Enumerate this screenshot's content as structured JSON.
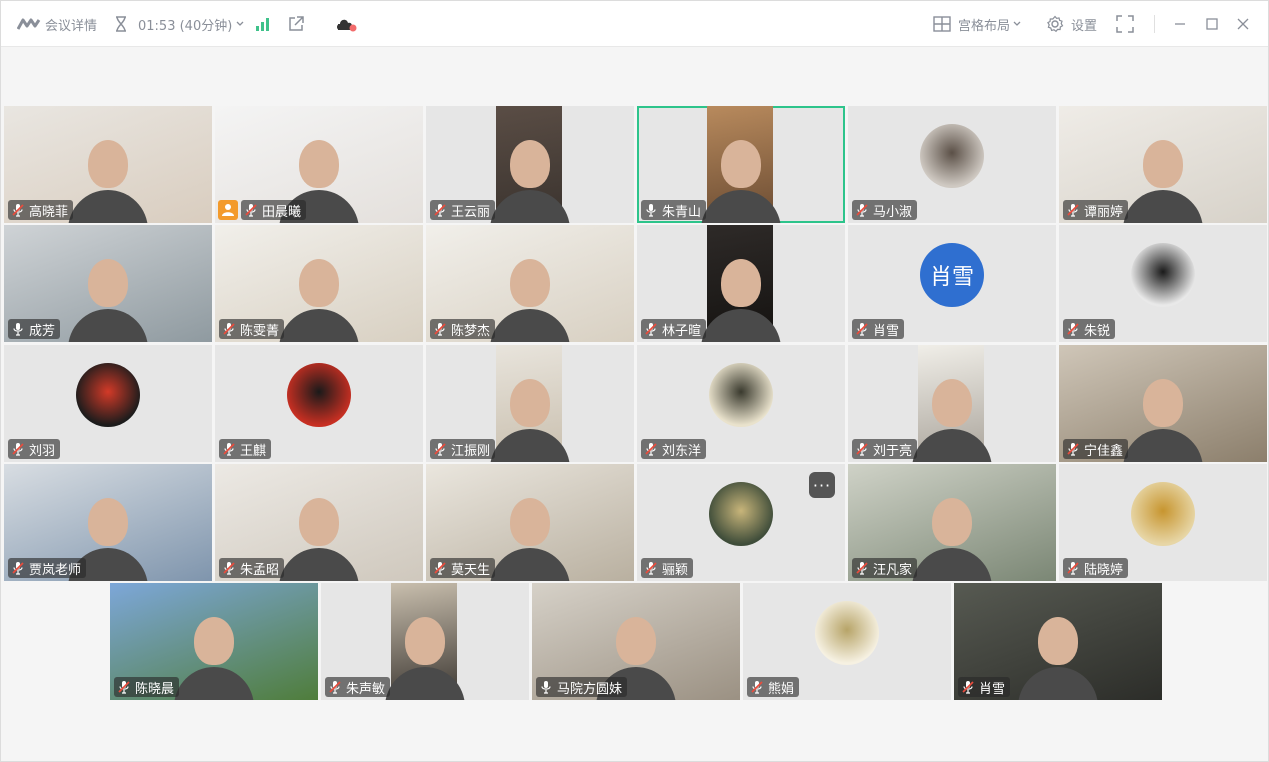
{
  "titlebar": {
    "meeting_details_label": "会议详情",
    "timer": "01:53 (40分钟)",
    "layout_label": "宫格布局",
    "settings_label": "设置"
  },
  "colors": {
    "accent": "#2dc48b",
    "host_badge": "#f39a2b",
    "avatar_text_bg": "#2f6fd0",
    "mic_muted": "#e84c3d"
  },
  "participants": [
    {
      "name": "高晓菲",
      "mic": "muted",
      "video": "on"
    },
    {
      "name": "田晨曦",
      "mic": "muted",
      "video": "on",
      "host": true
    },
    {
      "name": "王云丽",
      "mic": "muted",
      "video": "on"
    },
    {
      "name": "朱青山",
      "mic": "on",
      "video": "on",
      "speaking": true
    },
    {
      "name": "马小淑",
      "mic": "muted",
      "video": "off"
    },
    {
      "name": "谭丽婷",
      "mic": "muted",
      "video": "on"
    },
    {
      "name": "成芳",
      "mic": "on",
      "video": "on"
    },
    {
      "name": "陈雯菁",
      "mic": "muted",
      "video": "on"
    },
    {
      "name": "陈梦杰",
      "mic": "muted",
      "video": "on"
    },
    {
      "name": "林子暄",
      "mic": "muted",
      "video": "on"
    },
    {
      "name": "肖雪",
      "mic": "muted",
      "video": "off",
      "avatar_text": "肖雪"
    },
    {
      "name": "朱锐",
      "mic": "muted",
      "video": "off"
    },
    {
      "name": "刘羽",
      "mic": "muted",
      "video": "off"
    },
    {
      "name": "王麒",
      "mic": "muted",
      "video": "off"
    },
    {
      "name": "江振刚",
      "mic": "muted",
      "video": "on"
    },
    {
      "name": "刘东洋",
      "mic": "muted",
      "video": "off"
    },
    {
      "name": "刘于亮",
      "mic": "muted",
      "video": "on"
    },
    {
      "name": "宁佳鑫",
      "mic": "muted",
      "video": "on"
    },
    {
      "name": "贾岚老师",
      "mic": "muted",
      "video": "on"
    },
    {
      "name": "朱孟昭",
      "mic": "muted",
      "video": "on"
    },
    {
      "name": "莫天生",
      "mic": "muted",
      "video": "on"
    },
    {
      "name": "骊颖",
      "mic": "muted",
      "video": "off"
    },
    {
      "name": "汪凡家",
      "mic": "muted",
      "video": "on"
    },
    {
      "name": "陆晓婷",
      "mic": "muted",
      "video": "off"
    },
    {
      "name": "陈晓晨",
      "mic": "muted",
      "video": "on"
    },
    {
      "name": "朱声敏",
      "mic": "muted",
      "video": "on"
    },
    {
      "name": "马院方圆妹",
      "mic": "on",
      "video": "on"
    },
    {
      "name": "熊娟",
      "mic": "muted",
      "video": "off"
    },
    {
      "name": "肖雪",
      "mic": "muted",
      "video": "on"
    }
  ]
}
